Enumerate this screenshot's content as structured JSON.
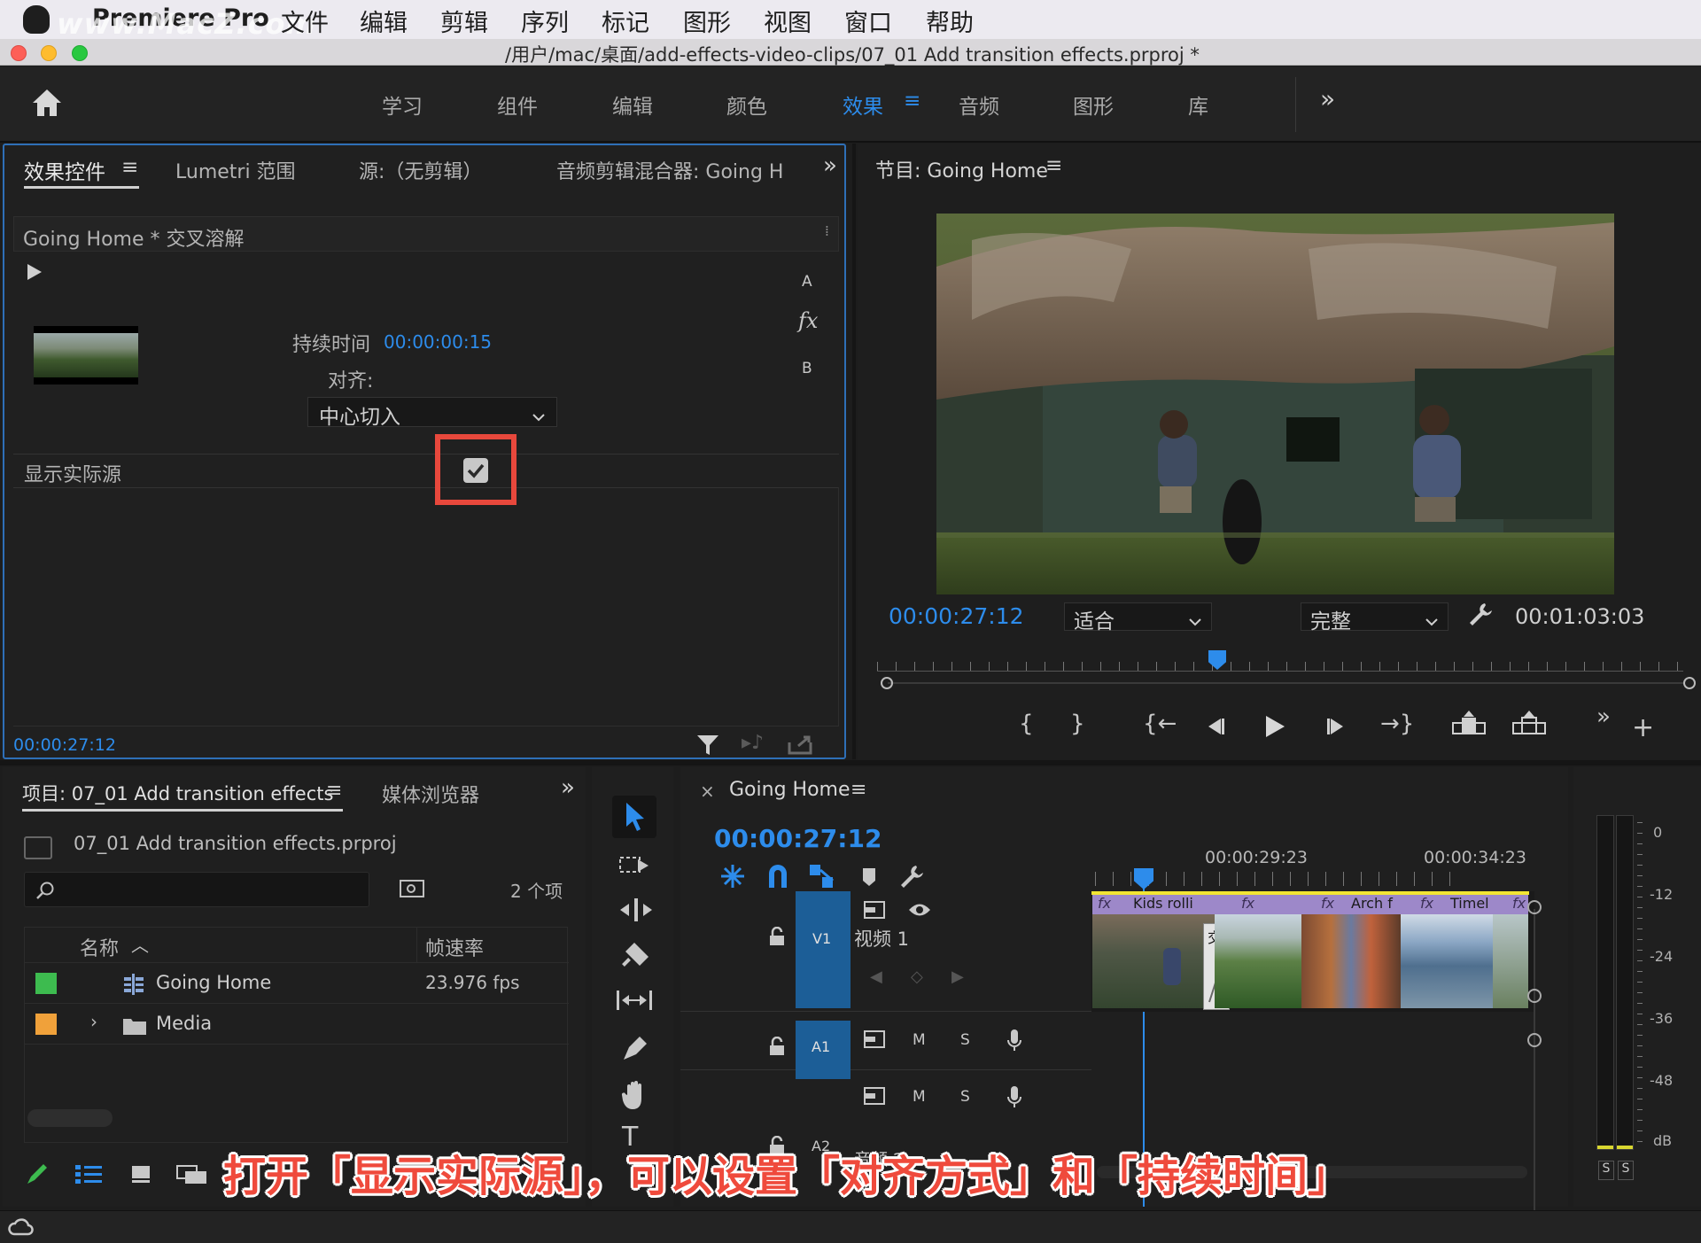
{
  "menubar": {
    "app_name": "Premiere Pro",
    "watermark": "www.MacZ.com",
    "items": [
      "文件",
      "编辑",
      "剪辑",
      "序列",
      "标记",
      "图形",
      "视图",
      "窗口",
      "帮助"
    ]
  },
  "window": {
    "title": "/用户/mac/桌面/add-effects-video-clips/07_01 Add transition effects.prproj *"
  },
  "workspaces": {
    "tabs": [
      "学习",
      "组件",
      "编辑",
      "颜色",
      "效果",
      "音频",
      "图形",
      "库"
    ],
    "active": "效果",
    "more": "»"
  },
  "effect_controls": {
    "tabs": [
      "效果控件",
      "Lumetri 范围",
      "源:（无剪辑）",
      "音频剪辑混合器: Going H"
    ],
    "menu_glyph": "≡",
    "header": "Going Home * 交叉溶解",
    "label_a": "A",
    "label_b": "B",
    "fx_glyph": "fx",
    "duration_label": "持续时间",
    "duration_value": "00:00:00:15",
    "alignment_label": "对齐:",
    "alignment_value": "中心切入",
    "show_actual_sources_label": "显示实际源",
    "show_actual_sources_checked": true,
    "timecode": "00:00:27:12"
  },
  "program_monitor": {
    "title": "节目: Going Home",
    "timecode": "00:00:27:12",
    "fit_value": "适合",
    "quality_value": "完整",
    "duration": "00:01:03:03"
  },
  "project": {
    "tabs": [
      "项目: 07_01 Add transition effects",
      "媒体浏览器"
    ],
    "file": "07_01 Add transition effects.prproj",
    "item_count": "2 个项",
    "columns": [
      "名称",
      "帧速率"
    ],
    "rows": [
      {
        "name": "Going Home",
        "fps": "23.976 fps",
        "color": "#3dbb4f"
      },
      {
        "name": "Media",
        "fps": "",
        "color": "#f0a13a"
      }
    ]
  },
  "timeline": {
    "title": "Going Home",
    "close": "×",
    "timecode": "00:00:27:12",
    "ruler_labels": [
      "00:00:29:23",
      "00:00:34:23"
    ],
    "tracks": [
      {
        "id": "V1",
        "name": "视频 1"
      },
      {
        "id": "A1",
        "name": ""
      },
      {
        "id": "A2",
        "name": "音频 2"
      }
    ],
    "clips": [
      "Kids rolli",
      "Arch f",
      "Timel"
    ],
    "transition_label": "交",
    "track_buttons": [
      "M",
      "S"
    ]
  },
  "meter": {
    "labels": [
      "0",
      "-12",
      "-24",
      "-36",
      "-48",
      "dB"
    ],
    "solo": [
      "S",
      "S"
    ]
  },
  "caption": "打开「显示实际源」，可以设置「对齐方式」和「持续时间」"
}
